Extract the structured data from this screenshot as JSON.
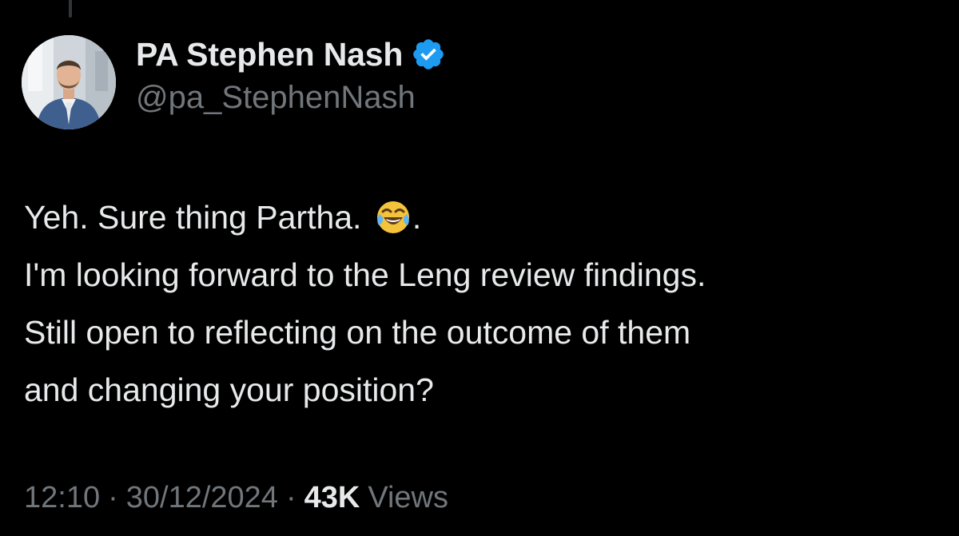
{
  "author": {
    "display_name": "PA Stephen Nash",
    "handle": "@pa_StephenNash",
    "verified": true,
    "verified_color": "#1d9bf0",
    "avatar_icon": "profile-photo"
  },
  "tweet": {
    "line1_text": "Yeh. Sure thing Partha. ",
    "line1_emoji": "face-with-tears-of-joy-icon",
    "line1_end": ".",
    "line2": "I'm looking forward to the Leng review findings.",
    "line3": "Still open to reflecting on the outcome of them",
    "line4": "and changing your position?"
  },
  "meta": {
    "time": "12:10",
    "separator": "·",
    "date": "30/12/2024",
    "views_count": "43K",
    "views_label": "Views"
  },
  "colors": {
    "background": "#000000",
    "primary_text": "#e7e9ea",
    "secondary_text": "#71767b",
    "accent": "#1d9bf0"
  }
}
